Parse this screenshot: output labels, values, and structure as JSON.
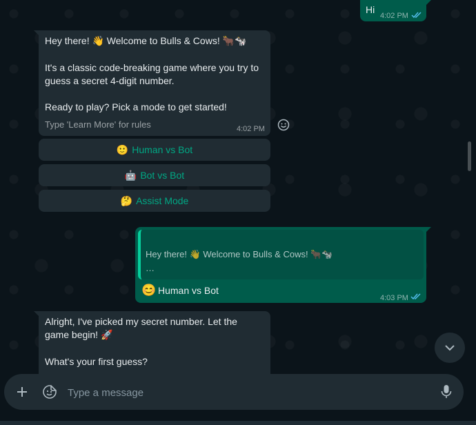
{
  "messages": {
    "hi": {
      "text": "Hi",
      "time": "4:02 PM"
    },
    "welcome": {
      "line1": "Hey there! 👋 Welcome to Bulls & Cows! 🐂🐄",
      "line2": "It's a classic code-breaking game where you try to guess a secret 4-digit number.",
      "line3": "Ready to play? Pick a mode to get started!",
      "footer": "Type 'Learn More' for rules",
      "time": "4:02 PM"
    },
    "buttons": [
      {
        "emoji": "🙂",
        "label": "Human vs Bot"
      },
      {
        "emoji": "🤖",
        "label": "Bot vs Bot"
      },
      {
        "emoji": "🤔",
        "label": "Assist Mode"
      }
    ],
    "reply": {
      "quote": "Hey there! 👋 Welcome to Bulls & Cows! 🐂🐄",
      "ellipsis": "…",
      "emoji": "😊",
      "text": "Human vs Bot",
      "time": "4:03 PM"
    },
    "game": {
      "line1": "Alright, I've picked my secret number. Let the game begin! 🚀",
      "line2": "What's your first guess?"
    }
  },
  "composer": {
    "placeholder": "Type a message"
  },
  "icons": {
    "add": "plus-icon",
    "sticker": "sticker-icon",
    "mic": "mic-icon",
    "react": "emoji-react-icon",
    "scroll": "chevron-down-icon",
    "read": "double-check-icon"
  },
  "colors": {
    "background": "#0b141a",
    "incoming": "#202c33",
    "outgoing": "#005c4b",
    "accent": "#00a884",
    "read_ticks": "#53bdeb"
  }
}
